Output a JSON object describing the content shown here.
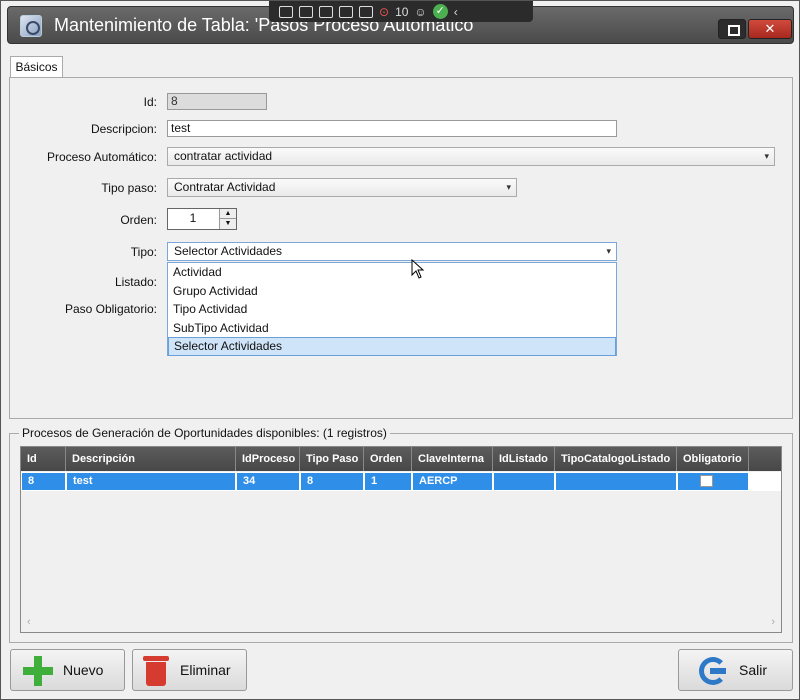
{
  "window": {
    "title": "Mantenimiento de Tabla: 'Pasos Proceso Automático'"
  },
  "overlay_toolbar": {
    "counter": "10"
  },
  "tabs": [
    {
      "label": "Básicos"
    }
  ],
  "form": {
    "id": {
      "label": "Id:",
      "value": "8"
    },
    "descripcion": {
      "label": "Descripcion:",
      "value": "test"
    },
    "proceso": {
      "label": "Proceso Automático:",
      "value": "contratar actividad"
    },
    "tipo_paso": {
      "label": "Tipo paso:",
      "value": "Contratar Actividad"
    },
    "orden": {
      "label": "Orden:",
      "value": "1"
    },
    "tipo": {
      "label": "Tipo:",
      "value": "Selector Actividades",
      "options": [
        "Actividad",
        "Grupo Actividad",
        "Tipo Actividad",
        "SubTipo Actividad",
        "Selector Actividades"
      ]
    },
    "listado": {
      "label": "Listado:"
    },
    "paso_obligatorio": {
      "label": "Paso Obligatorio:"
    }
  },
  "grid": {
    "title": "Procesos de Generación de Oportunidades disponibles:  (1 registros)",
    "columns": [
      "Id",
      "Descripción",
      "IdProceso",
      "Tipo Paso",
      "Orden",
      "ClaveInterna",
      "IdListado",
      "TipoCatalogoListado",
      "Obligatorio"
    ],
    "rows": [
      [
        "8",
        "test",
        "34",
        "8",
        "1",
        "AERCP",
        "",
        "",
        ""
      ]
    ],
    "scroll_left": "‹",
    "scroll_right": "›"
  },
  "buttons": {
    "nuevo": "Nuevo",
    "eliminar": "Eliminar",
    "salir": "Salir"
  },
  "colors": {
    "selection": "#2f8ee8",
    "title_bar": "#555555",
    "close": "#c0392b"
  }
}
